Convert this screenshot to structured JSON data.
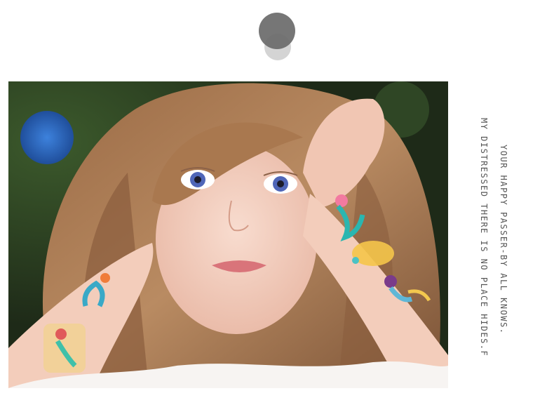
{
  "logo": {
    "icon": "overlapping-circles-logo",
    "colors": [
      "#6a6a6a",
      "#cfcfcf"
    ]
  },
  "photo": {
    "subject": "girl-with-mermaid-tattoos",
    "background_accent": "#2a6bd8"
  },
  "side_text": {
    "line1": "MY DISTRESSED THERE IS NO PLACE HIDES.F",
    "line2": "YOUR HAPPY PASSER-BY ALL KNOWS."
  }
}
